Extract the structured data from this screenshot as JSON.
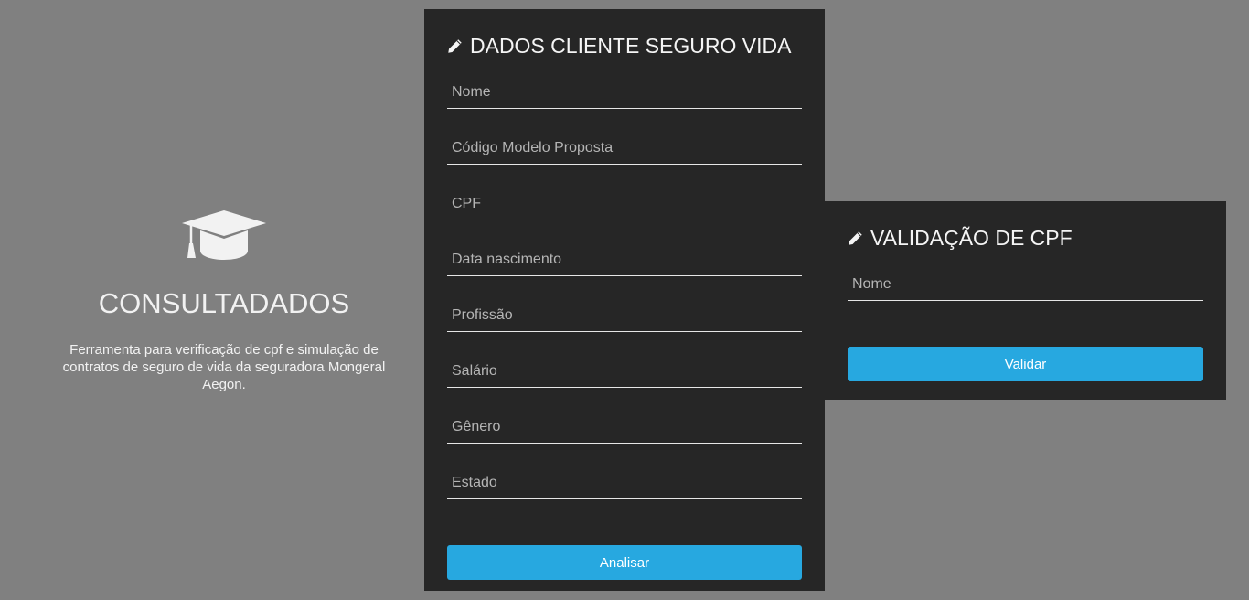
{
  "brand": {
    "icon": "graduation-cap-icon",
    "title": "CONSULTADADOS",
    "description": "Ferramenta para verificação de cpf e simulação de contratos de seguro de vida da seguradora Mongeral Aegon."
  },
  "client_form": {
    "icon": "pencil-icon",
    "title": "DADOS CLIENTE SEGURO VIDA",
    "fields": [
      {
        "placeholder": "Nome",
        "value": ""
      },
      {
        "placeholder": "Código Modelo Proposta",
        "value": ""
      },
      {
        "placeholder": "CPF",
        "value": ""
      },
      {
        "placeholder": "Data nascimento",
        "value": ""
      },
      {
        "placeholder": "Profissão",
        "value": ""
      },
      {
        "placeholder": "Salário",
        "value": ""
      },
      {
        "placeholder": "Gênero",
        "value": ""
      },
      {
        "placeholder": "Estado",
        "value": ""
      }
    ],
    "submit_label": "Analisar"
  },
  "cpf_form": {
    "icon": "pencil-icon",
    "title": "VALIDAÇÃO DE CPF",
    "fields": [
      {
        "placeholder": "Nome",
        "value": ""
      }
    ],
    "submit_label": "Validar"
  },
  "colors": {
    "page_background": "#808080",
    "panel_background": "#262626",
    "button_accent": "#27a8e0",
    "text": "#f2f2f2"
  }
}
